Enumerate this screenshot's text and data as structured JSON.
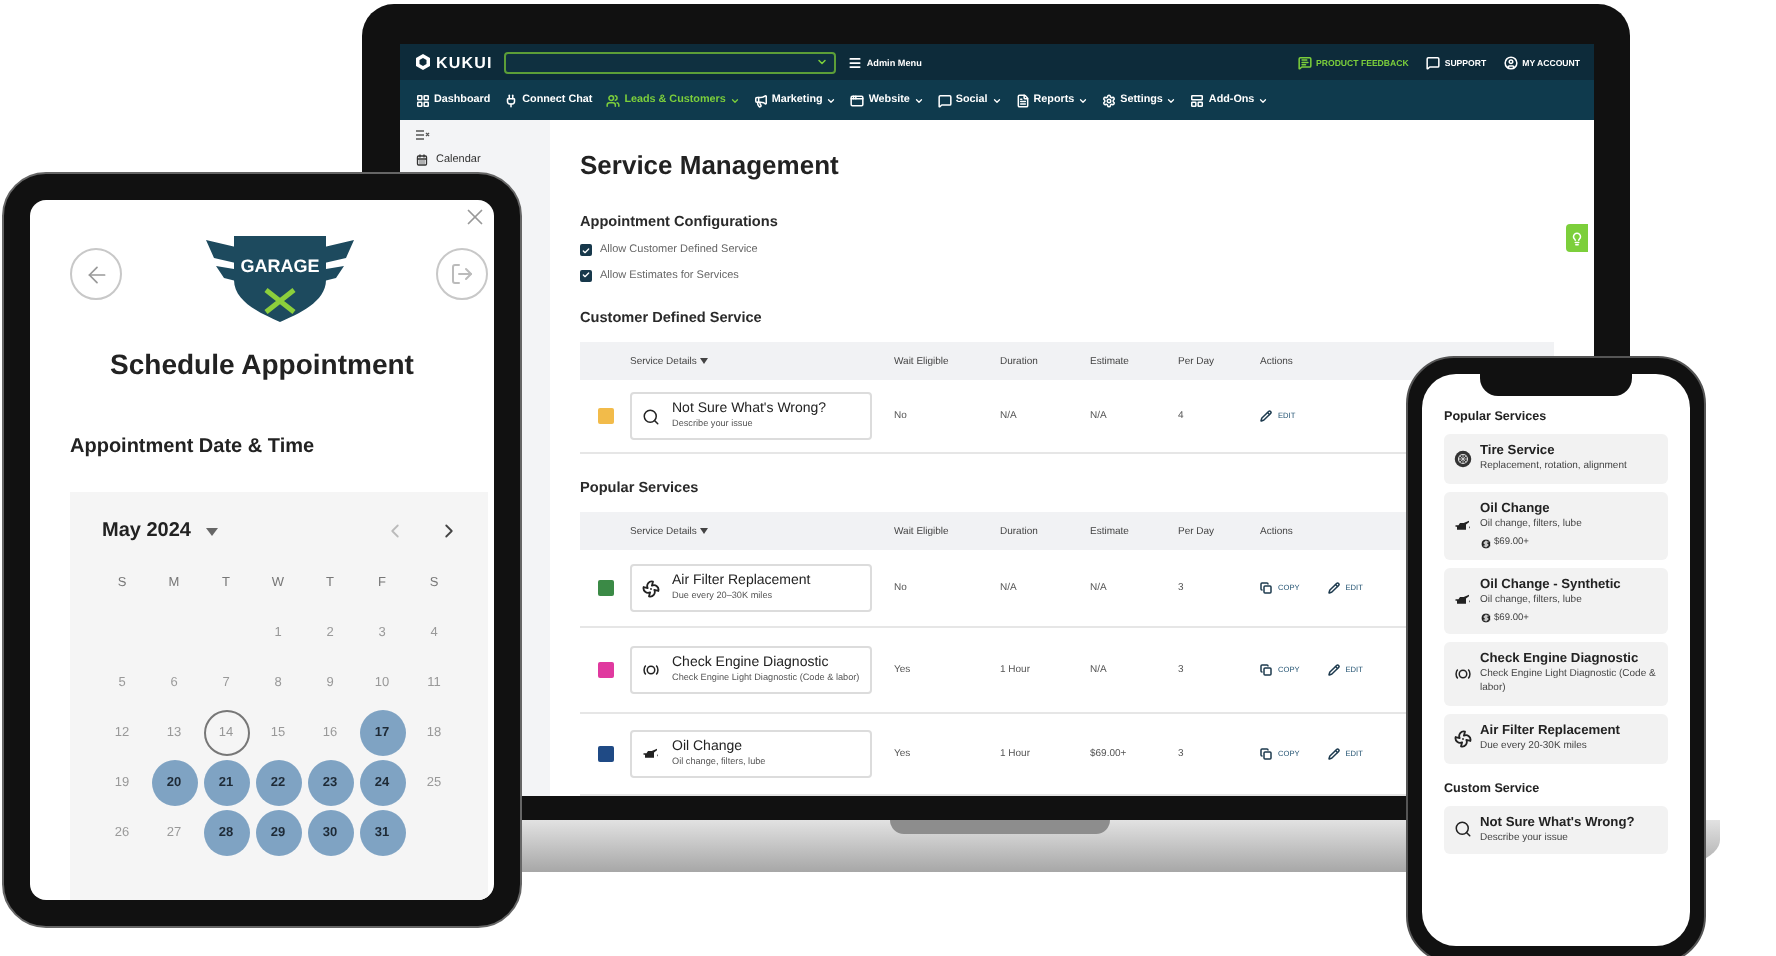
{
  "laptop": {
    "brand": "KUKUI",
    "admin_menu": "Admin Menu",
    "top_links": [
      {
        "kind": "feedback",
        "label": "PRODUCT FEEDBACK"
      },
      {
        "kind": "support",
        "label": "SUPPORT"
      },
      {
        "kind": "account",
        "label": "MY ACCOUNT"
      }
    ],
    "nav": [
      {
        "kind": "grid",
        "label": "Dashboard",
        "dropdown": false,
        "selected": false
      },
      {
        "kind": "plug",
        "label": "Connect Chat",
        "dropdown": false,
        "selected": false
      },
      {
        "kind": "people",
        "label": "Leads & Customers",
        "dropdown": true,
        "selected": true
      },
      {
        "kind": "megaphone",
        "label": "Marketing",
        "dropdown": true,
        "selected": false
      },
      {
        "kind": "window",
        "label": "Website",
        "dropdown": true,
        "selected": false
      },
      {
        "kind": "chat",
        "label": "Social",
        "dropdown": true,
        "selected": false
      },
      {
        "kind": "document",
        "label": "Reports",
        "dropdown": true,
        "selected": false
      },
      {
        "kind": "gear",
        "label": "Settings",
        "dropdown": true,
        "selected": false
      },
      {
        "kind": "panel",
        "label": "Add-Ons",
        "dropdown": true,
        "selected": false
      }
    ],
    "sidebar": {
      "items": [
        {
          "kind": "calendar",
          "label": "Calendar"
        }
      ]
    },
    "title": "Service Management",
    "configurations": {
      "title": "Appointment Configurations",
      "options": [
        {
          "label": "Allow Customer Defined Service",
          "checked": true
        },
        {
          "label": "Allow Estimates for Services",
          "checked": true
        }
      ]
    },
    "sections": [
      {
        "title": "Customer Defined Service",
        "columns": [
          {
            "label": "Service Details",
            "sortable": true
          },
          {
            "label": "Wait Eligible",
            "sortable": false
          },
          {
            "label": "Duration",
            "sortable": false
          },
          {
            "label": "Estimate",
            "sortable": false
          },
          {
            "label": "Per Day",
            "sortable": false
          },
          {
            "label": "Actions",
            "sortable": false
          }
        ],
        "rows": [
          {
            "color": "#f2bb4a",
            "kind": "search",
            "name": "Not Sure What's Wrong?",
            "description": "Describe your issue",
            "wait_eligible": "No",
            "duration": "N/A",
            "estimate": "N/A",
            "per_day": "4",
            "actions": [
              {
                "kind": "edit",
                "label": "EDIT"
              }
            ]
          }
        ]
      },
      {
        "title": "Popular Services",
        "columns": [
          {
            "label": "Service Details",
            "sortable": true
          },
          {
            "label": "Wait Eligible",
            "sortable": false
          },
          {
            "label": "Duration",
            "sortable": false
          },
          {
            "label": "Estimate",
            "sortable": false
          },
          {
            "label": "Per Day",
            "sortable": false
          },
          {
            "label": "Actions",
            "sortable": false
          }
        ],
        "rows": [
          {
            "color": "#3b8a46",
            "kind": "fan",
            "name": "Air Filter Replacement",
            "description": "Due every 20–30K miles",
            "wait_eligible": "No",
            "duration": "N/A",
            "estimate": "N/A",
            "per_day": "3",
            "actions": [
              {
                "kind": "copy",
                "label": "COPY"
              },
              {
                "kind": "edit",
                "label": "EDIT"
              }
            ]
          },
          {
            "color": "#e0399f",
            "kind": "engine",
            "name": "Check Engine Diagnostic",
            "description": "Check Engine Light Diagnostic (Code & labor)",
            "wait_eligible": "Yes",
            "duration": "1 Hour",
            "estimate": "N/A",
            "per_day": "3",
            "actions": [
              {
                "kind": "copy",
                "label": "COPY"
              },
              {
                "kind": "edit",
                "label": "EDIT"
              }
            ]
          },
          {
            "color": "#1f4a85",
            "kind": "oil",
            "name": "Oil Change",
            "description": "Oil change, filters, lube",
            "wait_eligible": "Yes",
            "duration": "1 Hour",
            "estimate": "$69.00+",
            "per_day": "3",
            "actions": [
              {
                "kind": "copy",
                "label": "COPY"
              },
              {
                "kind": "edit",
                "label": "EDIT"
              }
            ]
          }
        ]
      }
    ]
  },
  "tablet": {
    "logo": "GARAGE",
    "title": "Schedule Appointment",
    "subtitle": "Appointment Date & Time",
    "month": "May 2024",
    "weekdays": [
      "S",
      "M",
      "T",
      "W",
      "T",
      "F",
      "S"
    ],
    "weeks": [
      [
        {
          "label": "1",
          "available": false,
          "today": false
        },
        {
          "label": "2",
          "available": false,
          "today": false
        },
        {
          "label": "3",
          "available": false,
          "today": false
        },
        {
          "label": "4",
          "available": false,
          "today": false
        }
      ],
      [
        {
          "label": "5",
          "available": false,
          "today": false
        },
        {
          "label": "6",
          "available": false,
          "today": false
        },
        {
          "label": "7",
          "available": false,
          "today": false
        },
        {
          "label": "8",
          "available": false,
          "today": false
        },
        {
          "label": "9",
          "available": false,
          "today": false
        },
        {
          "label": "10",
          "available": false,
          "today": false
        },
        {
          "label": "11",
          "available": false,
          "today": false
        }
      ],
      [
        {
          "label": "12",
          "available": false,
          "today": false
        },
        {
          "label": "13",
          "available": false,
          "today": false
        },
        {
          "label": "14",
          "available": false,
          "today": true
        },
        {
          "label": "15",
          "available": false,
          "today": false
        },
        {
          "label": "16",
          "available": false,
          "today": false
        },
        {
          "label": "17",
          "available": true,
          "today": false
        },
        {
          "label": "18",
          "available": false,
          "today": false
        }
      ],
      [
        {
          "label": "19",
          "available": false,
          "today": false
        },
        {
          "label": "20",
          "available": true,
          "today": false
        },
        {
          "label": "21",
          "available": true,
          "today": false
        },
        {
          "label": "22",
          "available": true,
          "today": false
        },
        {
          "label": "23",
          "available": true,
          "today": false
        },
        {
          "label": "24",
          "available": true,
          "today": false
        },
        {
          "label": "25",
          "available": false,
          "today": false
        }
      ],
      [
        {
          "label": "26",
          "available": false,
          "today": false
        },
        {
          "label": "27",
          "available": false,
          "today": false
        },
        {
          "label": "28",
          "available": true,
          "today": false
        },
        {
          "label": "29",
          "available": true,
          "today": false
        },
        {
          "label": "30",
          "available": true,
          "today": false
        },
        {
          "label": "31",
          "available": true,
          "today": false
        }
      ]
    ]
  },
  "phone": {
    "sections": [
      {
        "title": "Popular Services",
        "cards": [
          {
            "kind": "tire",
            "name": "Tire Service",
            "description": "Replacement, rotation, alignment"
          },
          {
            "kind": "oil",
            "name": "Oil Change",
            "description": "Oil change, filters, lube",
            "price": "$69.00+"
          },
          {
            "kind": "oil",
            "name": "Oil Change - Synthetic",
            "description": "Oil change, filters, lube",
            "price": "$69.00+"
          },
          {
            "kind": "engine",
            "name": "Check Engine Diagnostic",
            "description": "Check Engine Light Diagnostic (Code & labor)"
          },
          {
            "kind": "fan",
            "name": "Air Filter Replacement",
            "description": "Due every 20-30K miles"
          }
        ]
      },
      {
        "title": "Custom Service",
        "cards": [
          {
            "kind": "search",
            "name": "Not Sure What's Wrong?",
            "description": "Describe your issue"
          }
        ]
      }
    ]
  }
}
